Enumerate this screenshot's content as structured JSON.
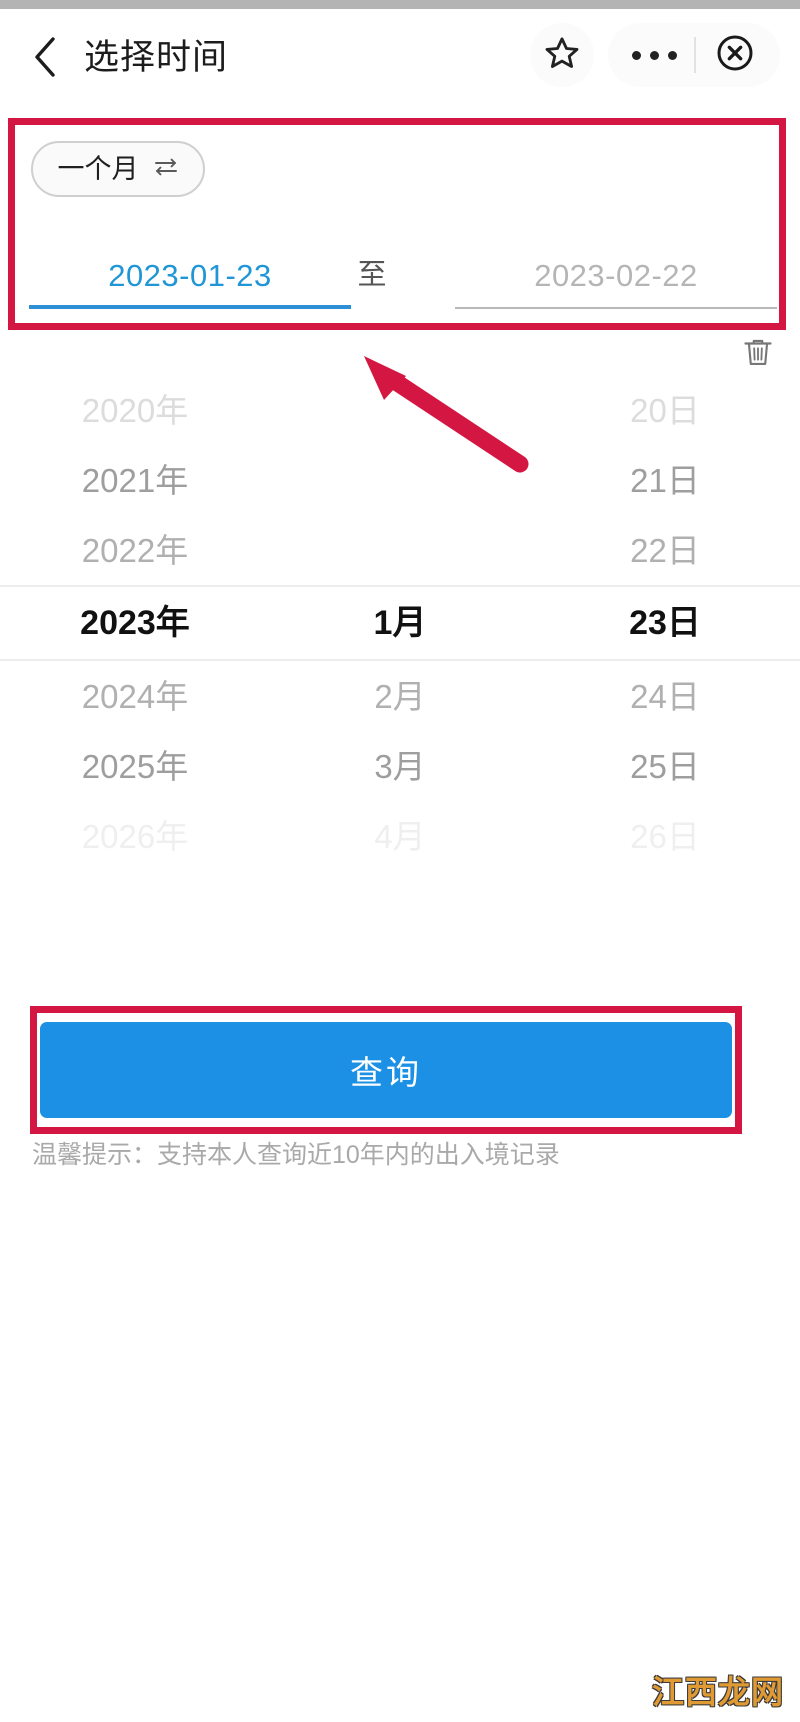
{
  "header": {
    "title": "选择时间",
    "back_icon": "chevron-left-icon",
    "star_icon": "star-icon",
    "more_icon": "more-dots-icon",
    "close_icon": "circle-close-icon"
  },
  "range": {
    "chip_label": "一个月",
    "chip_swap_icon": "swap-arrows-icon",
    "start_date": "2023-01-23",
    "separator": "至",
    "end_date": "2023-02-22",
    "active_color": "#2196d6",
    "inactive_color": "#b5b5b5",
    "trash_icon": "trash-icon"
  },
  "picker": {
    "rows": [
      {
        "year": "2020年",
        "month": "",
        "day": "20日",
        "state": "d4"
      },
      {
        "year": "2021年",
        "month": "",
        "day": "21日",
        "state": "d3"
      },
      {
        "year": "2022年",
        "month": "",
        "day": "22日",
        "state": "d2"
      },
      {
        "year": "2023年",
        "month": "1月",
        "day": "23日",
        "state": "sel"
      },
      {
        "year": "2024年",
        "month": "2月",
        "day": "24日",
        "state": "d2"
      },
      {
        "year": "2025年",
        "month": "3月",
        "day": "25日",
        "state": "d3"
      },
      {
        "year": "2026年",
        "month": "4月",
        "day": "26日",
        "state": "d5"
      }
    ],
    "selected": {
      "year": "2023年",
      "month": "1月",
      "day": "23日"
    }
  },
  "footer": {
    "submit_label": "查询",
    "submit_color": "#1b90e4",
    "tip": "温馨提示：支持本人查询近10年内的出入境记录"
  },
  "watermark": {
    "text": "江西龙网",
    "color": "#e09a33"
  },
  "annotations": {
    "highlight_color": "#d41742",
    "box_range": "date-range-highlight",
    "box_button": "submit-button-highlight",
    "arrow": "pointer-arrow"
  }
}
